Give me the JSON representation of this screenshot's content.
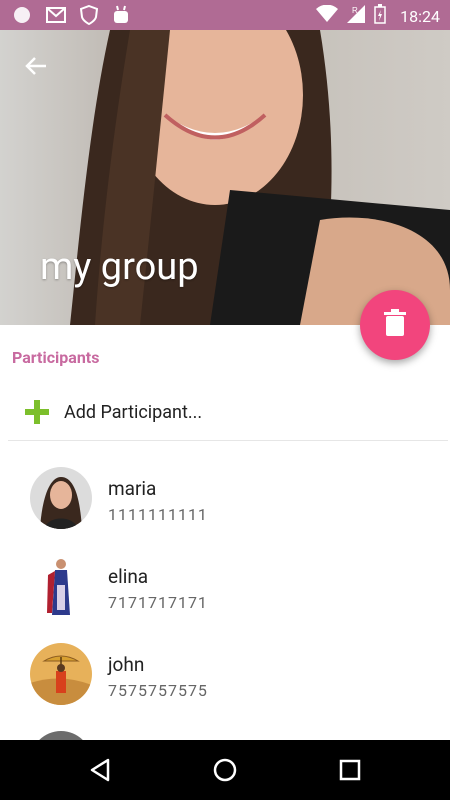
{
  "status_bar": {
    "time": "18:24",
    "network_indicator": "R",
    "icons": [
      "pinwheel-icon",
      "mail-icon",
      "shield-icon",
      "android-icon",
      "wifi-icon",
      "signal-icon",
      "battery-icon"
    ]
  },
  "header": {
    "group_name": "my group"
  },
  "section": {
    "participants_label": "Participants",
    "add_participant_label": "Add Participant..."
  },
  "participants": [
    {
      "name": "maria",
      "phone": "1111111111"
    },
    {
      "name": "elina",
      "phone": "7171717171"
    },
    {
      "name": "john",
      "phone": "7575757575"
    }
  ],
  "colors": {
    "status_bar": "#b06b94",
    "accent_label": "#c86aa0",
    "fab": "#f2457d",
    "add_icon": "#7cbf2b"
  }
}
